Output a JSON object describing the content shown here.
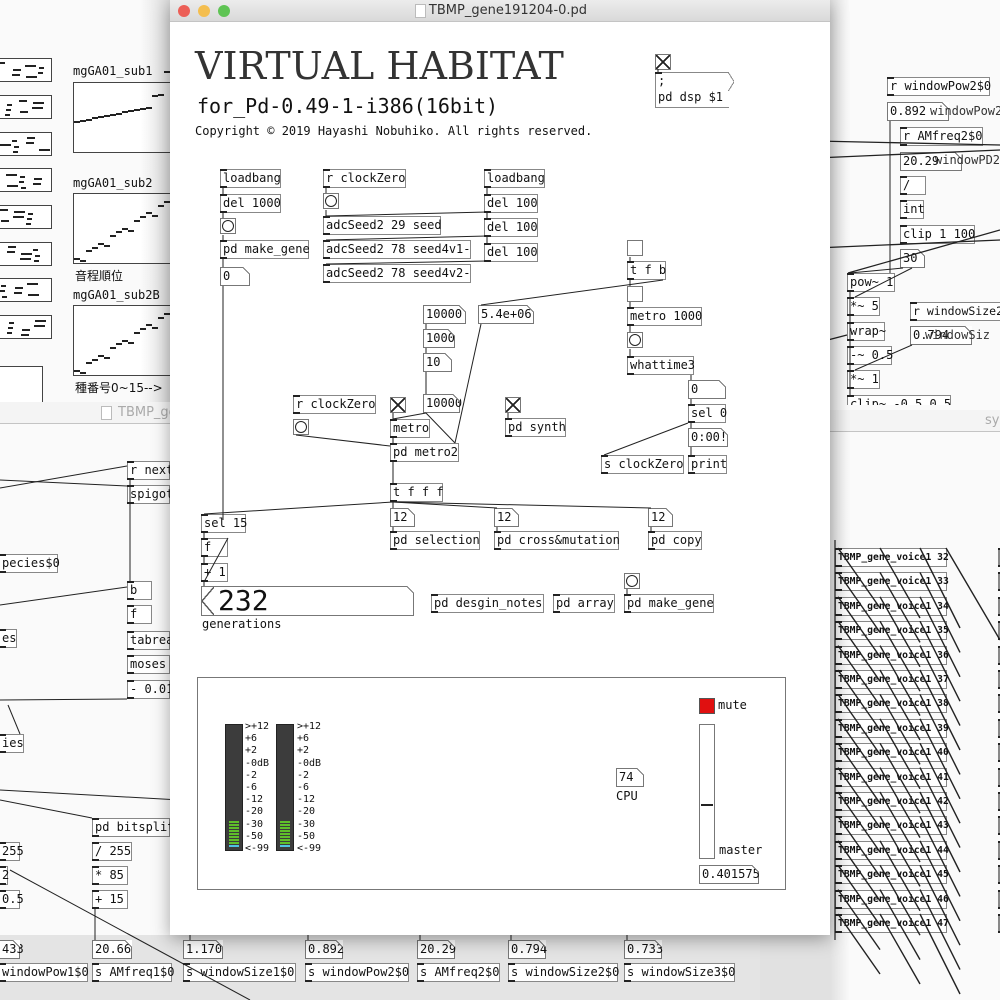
{
  "left_top_window": {
    "arrays": [
      {
        "label": "mgGA01_sub1"
      },
      {
        "label": "mgGA01_sub2",
        "caption": "音程順位"
      },
      {
        "label": "mgGA01_sub2B",
        "caption": "種番号0~15-->"
      }
    ]
  },
  "left_bottom_window": {
    "title": "TBMP_ge",
    "objects": [
      "r next",
      "spigot",
      "pecies$0",
      "b",
      "f",
      "es",
      "tabrea",
      "moses",
      "- 0.01",
      "ies",
      "pd bitsplit",
      "/ 255",
      "* 85",
      "+ 15",
      "255",
      "2",
      "0.5",
      "433",
      "windowPow1$0",
      "20.66",
      "s AMfreq1$0",
      "1.170",
      "s windowSize1$0",
      "0.892",
      "s windowPow2$0",
      "20.29",
      "s AMfreq2$0",
      "0.794",
      "s windowSize2$0",
      "0.733",
      "s windowSize3$0"
    ]
  },
  "right_top_window": {
    "objects": [
      "r windowPow2$0",
      "0.892",
      "r AMfreq2$0",
      "20.29",
      "/",
      "int",
      "clip 1 100",
      "30",
      "pow~ 1",
      "*~ 5",
      "wrap~",
      "-~ 0.5",
      "*~ 1",
      "clip~ -0.5 0.5",
      "r windowSize2",
      "0.794"
    ],
    "overlay_labels": [
      "windowPow2",
      "windowPD2",
      "windowSiz"
    ]
  },
  "right_bottom_window": {
    "title": "sy",
    "voices": [
      "TBMP_gene_voice1 32",
      "TBMP_gene_voice1 33",
      "TBMP_gene_voice1 34",
      "TBMP_gene_voice1 35",
      "TBMP_gene_voice1 36",
      "TBMP_gene_voice1 37",
      "TBMP_gene_voice1 38",
      "TBMP_gene_voice1 39",
      "TBMP_gene_voice1 40",
      "TBMP_gene_voice1 41",
      "TBMP_gene_voice1 42",
      "TBMP_gene_voice1 43",
      "TBMP_gene_voice1 44",
      "TBMP_gene_voice1 45",
      "TBMP_gene_voice1 46",
      "TBMP_gene_voice1 47"
    ]
  },
  "main_window": {
    "title": "TBMP_gene191204-0.pd",
    "heading": "VIRTUAL HABITAT",
    "subtitle": "for_Pd-0.49-1-i386(16bit)",
    "copyright": "Copyright © 2019 Hayashi Nobuhiko. All rights reserved.",
    "dsp_message": [
      ";",
      "pd dsp $1"
    ],
    "objects": [
      "loadbang",
      "del 1000",
      "pd make_gene",
      "0",
      "r clockZero",
      "adcSeed2 29 seed",
      "adcSeed2 78 seed4v1-",
      "adcSeed2 78 seed4v2-",
      "loadbang",
      "del 100",
      "del 100",
      "del 100",
      "t f b",
      "metro 1000",
      "whattime3",
      "0",
      "sel 0",
      "0:00!",
      "print",
      "s clockZero",
      "10000",
      "1000",
      "10",
      "10000",
      "5.4e+06",
      "r clockZero",
      "metro",
      "pd metro2",
      "pd synth",
      "t f f f",
      "12",
      "pd selection",
      "12",
      "pd cross&mutation",
      "12",
      "pd copy",
      "sel 15",
      "f",
      "+ 1",
      "pd desgin_notes",
      "pd array",
      "pd make_gene"
    ],
    "generations": {
      "value": "232",
      "label": "generations"
    },
    "panel": {
      "vu_labels": [
        ">+12",
        "+6",
        "+2",
        "-0dB",
        "-2",
        "-6",
        "-12",
        "-20",
        "-30",
        "-50",
        "<-99"
      ],
      "mute_label": "mute",
      "mute_color": "#e01010",
      "master_label": "master",
      "master_value": "0.401575",
      "master_level": 0.401575,
      "cpu_value": "74",
      "cpu_label": "CPU",
      "vu_active_color": "#5fbf2a"
    }
  }
}
